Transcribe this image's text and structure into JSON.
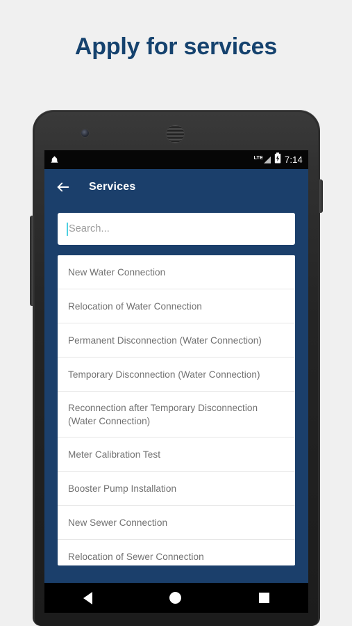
{
  "headline": "Apply for services",
  "status_bar": {
    "notification_icon": "bell-icon",
    "network_label": "LTE",
    "signal_icon": "signal-triangle-icon",
    "battery_icon": "battery-charging-icon",
    "clock": "7:14"
  },
  "app_bar": {
    "back_icon": "back-arrow-icon",
    "title": "Services"
  },
  "search": {
    "placeholder": "Search...",
    "value": ""
  },
  "services": {
    "items": [
      {
        "label": "New Water Connection"
      },
      {
        "label": "Relocation of Water Connection"
      },
      {
        "label": "Permanent Disconnection (Water Connection)"
      },
      {
        "label": "Temporary Disconnection (Water Connection)"
      },
      {
        "label": "Reconnection after Temporary Disconnection (Water Connection)"
      },
      {
        "label": "Meter Calibration Test"
      },
      {
        "label": "Booster Pump Installation"
      },
      {
        "label": "New Sewer Connection"
      },
      {
        "label": "Relocation of Sewer Connection"
      }
    ]
  },
  "nav_bar": {
    "back_icon": "nav-back-icon",
    "home_icon": "nav-home-icon",
    "recents_icon": "nav-recents-icon"
  },
  "colors": {
    "page_background": "#f0f0f0",
    "headline": "#15426e",
    "app_bar": "#1b3f6b",
    "card": "#ffffff",
    "item_text": "#717171",
    "caret": "#4dd0e1"
  }
}
